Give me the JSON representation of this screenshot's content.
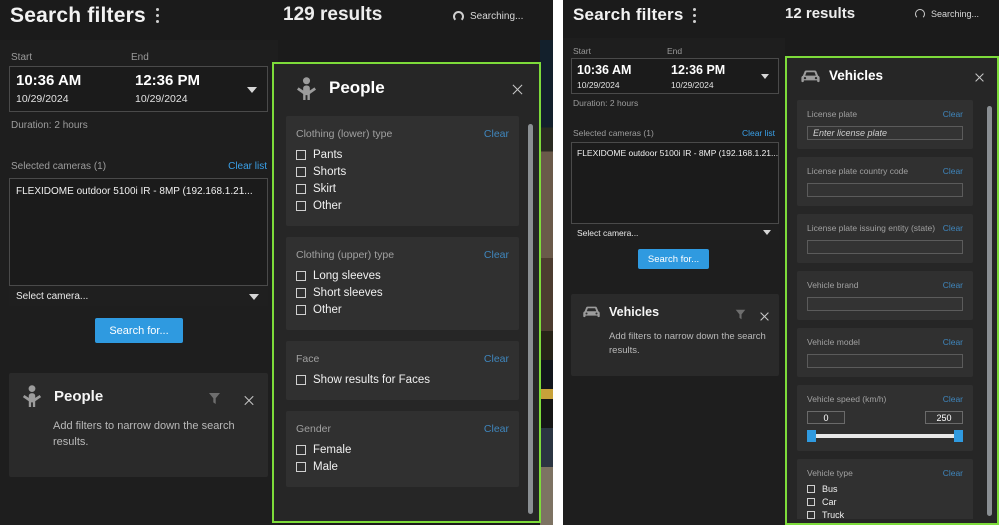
{
  "left": {
    "header": {
      "title": "Search filters",
      "kebab_icon": "more-vertical-icon",
      "results": "129 results",
      "searching": "Searching...",
      "spinner_icon": "loading-spinner-icon"
    },
    "timerange": {
      "start_label": "Start",
      "end_label": "End",
      "start_time": "10:36 AM",
      "start_date": "10/29/2024",
      "end_time": "12:36 PM",
      "end_date": "10/29/2024",
      "dropdown_icon": "chevron-down-icon",
      "duration": "Duration:  2 hours"
    },
    "cameras": {
      "label": "Selected cameras (1)",
      "clear_list": "Clear list",
      "items": [
        "FLEXIDOME outdoor 5100i IR - 8MP (192.168.1.21..."
      ],
      "select_placeholder": "Select camera...",
      "select_icon": "chevron-down-icon"
    },
    "search_button": "Search for...",
    "summary_card": {
      "icon": "person-icon",
      "title": "People",
      "text": "Add filters to narrow down the search results.",
      "filter_icon": "funnel-icon",
      "close_icon": "close-icon"
    },
    "flyout": {
      "icon": "person-icon",
      "title": "People",
      "close_icon": "close-icon",
      "groups": [
        {
          "label": "Clothing (lower) type",
          "clear": "Clear",
          "type": "checkboxes",
          "options": [
            "Pants",
            "Shorts",
            "Skirt",
            "Other"
          ]
        },
        {
          "label": "Clothing (upper) type",
          "clear": "Clear",
          "type": "checkboxes",
          "options": [
            "Long sleeves",
            "Short sleeves",
            "Other"
          ]
        },
        {
          "label": "Face",
          "clear": "Clear",
          "type": "checkboxes",
          "options": [
            "Show results for Faces"
          ]
        },
        {
          "label": "Gender",
          "clear": "Clear",
          "type": "checkboxes",
          "options": [
            "Female",
            "Male"
          ]
        }
      ]
    }
  },
  "right": {
    "header": {
      "title": "Search filters",
      "kebab_icon": "more-vertical-icon",
      "results": "12 results",
      "searching": "Searching...",
      "spinner_icon": "loading-spinner-icon"
    },
    "timerange": {
      "start_label": "Start",
      "end_label": "End",
      "start_time": "10:36 AM",
      "start_date": "10/29/2024",
      "end_time": "12:36 PM",
      "end_date": "10/29/2024",
      "dropdown_icon": "chevron-down-icon",
      "duration": "Duration: 2 hours"
    },
    "cameras": {
      "label": "Selected cameras (1)",
      "clear_list": "Clear list",
      "items": [
        "FLEXIDOME outdoor 5100i IR - 8MP (192.168.1.21..."
      ],
      "select_placeholder": "Select camera...",
      "select_icon": "chevron-down-icon"
    },
    "search_button": "Search for...",
    "summary_card": {
      "icon": "car-icon",
      "title": "Vehicles",
      "text": "Add filters to narrow down the search results.",
      "filter_icon": "funnel-icon",
      "close_icon": "close-icon"
    },
    "flyout": {
      "icon": "car-icon",
      "title": "Vehicles",
      "close_icon": "close-icon",
      "groups": [
        {
          "label": "License plate",
          "clear": "Clear",
          "type": "text",
          "value": "",
          "placeholder": "Enter license plate"
        },
        {
          "label": "License plate country code",
          "clear": "Clear",
          "type": "text",
          "value": "",
          "placeholder": ""
        },
        {
          "label": "License plate issuing entity (state)",
          "clear": "Clear",
          "type": "text",
          "value": "",
          "placeholder": ""
        },
        {
          "label": "Vehicle brand",
          "clear": "Clear",
          "type": "text",
          "value": "",
          "placeholder": ""
        },
        {
          "label": "Vehicle model",
          "clear": "Clear",
          "type": "text",
          "value": "",
          "placeholder": ""
        },
        {
          "label": "Vehicle speed (km/h)",
          "clear": "Clear",
          "type": "range",
          "min_value": "0",
          "max_value": "250"
        },
        {
          "label": "Vehicle type",
          "clear": "Clear",
          "type": "checkboxes",
          "options": [
            "Bus",
            "Car",
            "Truck"
          ]
        }
      ]
    }
  },
  "colors": {
    "accent_blue": "#2f9ae0",
    "highlight_green": "#7ddb3a",
    "link_blue": "#3aa0e8",
    "panel_bg": "#262626",
    "group_bg": "#303030",
    "app_bg": "#1b1b1b"
  }
}
